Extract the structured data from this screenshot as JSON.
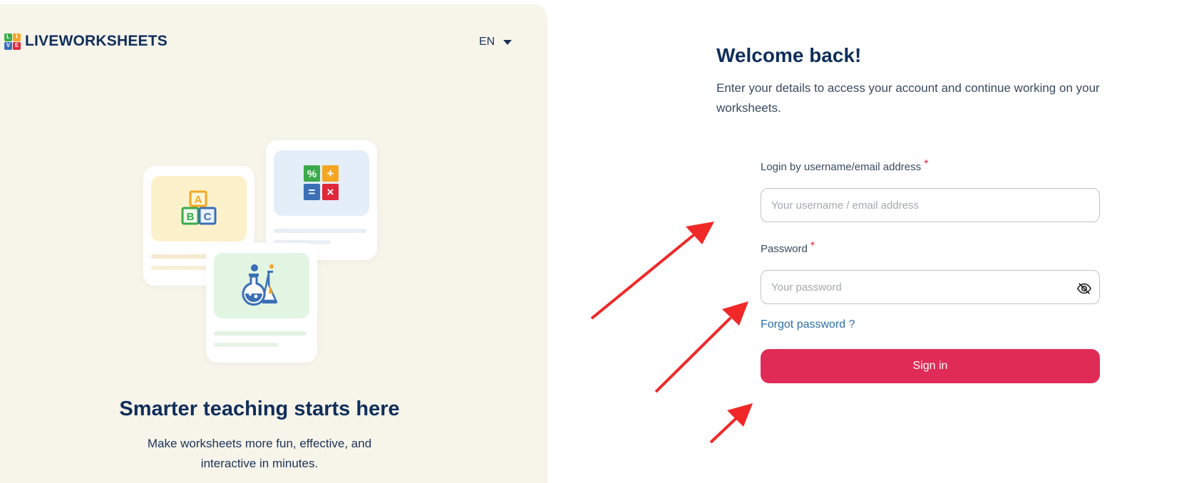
{
  "brand": {
    "name": "LIVEWORKSHEETS",
    "logo_letters": [
      "L",
      "I",
      "V",
      "E"
    ],
    "logo_colors": [
      "#3aaa4a",
      "#f5a623",
      "#3b6fb6",
      "#e0283a"
    ]
  },
  "language": {
    "selected": "EN"
  },
  "hero": {
    "title": "Smarter teaching starts here",
    "subtitle": "Make worksheets more fun, effective, and interactive in minutes.",
    "blocks_letters": [
      "A",
      "B",
      "C"
    ],
    "math_symbols": [
      "%",
      "+",
      "=",
      "×"
    ]
  },
  "login": {
    "heading": "Welcome back!",
    "description": "Enter your details to access your account and continue working on your worksheets.",
    "username_label": "Login by username/email address",
    "username_placeholder": "Your username / email address",
    "password_label": "Password",
    "password_placeholder": "Your password",
    "required_mark": "*",
    "forgot_link": "Forgot password ?",
    "submit_label": "Sign in"
  },
  "colors": {
    "panel_bg": "#f7f4ea",
    "navy": "#0f2e5a",
    "accent": "#e02b57",
    "link": "#2d6ea8",
    "annotation_arrow": "#f02828"
  },
  "icons": [
    "caret-down-icon",
    "eye-off-icon",
    "alphabet-blocks-icon",
    "math-symbols-icon",
    "science-flask-icon"
  ]
}
